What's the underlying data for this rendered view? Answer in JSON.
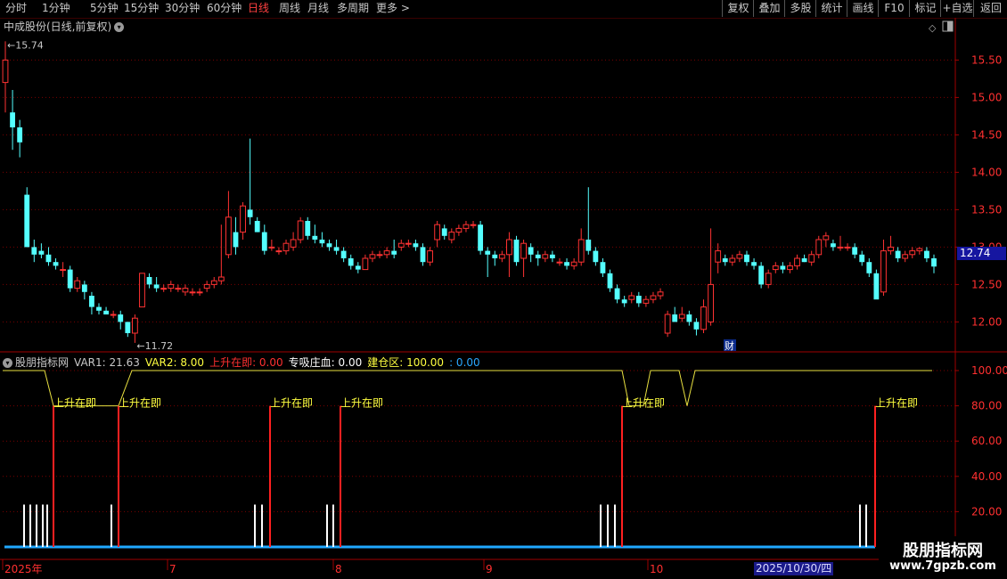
{
  "toolbar": {
    "tabs": [
      {
        "label": "分时",
        "active": false
      },
      {
        "label": "1分钟",
        "active": false
      },
      {
        "label": "5分钟",
        "active": false
      },
      {
        "label": "15分钟",
        "active": false
      },
      {
        "label": "30分钟",
        "active": false
      },
      {
        "label": "60分钟",
        "active": false
      },
      {
        "label": "日线",
        "active": true
      },
      {
        "label": "周线",
        "active": false
      },
      {
        "label": "月线",
        "active": false
      },
      {
        "label": "多周期",
        "active": false
      },
      {
        "label": "更多 >",
        "active": false
      }
    ],
    "right_buttons": [
      "复权",
      "叠加",
      "多股",
      "统计",
      "画线",
      "F10",
      "标记",
      "+自选",
      "返回"
    ]
  },
  "main_chart": {
    "title": "中成股份(日线,前复权)",
    "title_menu_icon": "chevron-down-icon",
    "high_label": "15.74",
    "low_label": "11.72",
    "marker_label": "财",
    "current_price": "12.74",
    "y_ticks": [
      "15.50",
      "15.00",
      "14.50",
      "14.00",
      "13.50",
      "13.00",
      "12.50",
      "12.00"
    ],
    "up_color": "#ff3232",
    "down_color": "#54ffff"
  },
  "indicator": {
    "name": "股朋指标网",
    "var1": "VAR1: 21.63",
    "var2": "VAR2: 8.00",
    "rise": "上升在即: 0.00",
    "zhuan": "专吸庄血: 0.00",
    "build": "建仓区: 100.00",
    "extra": ": 0.00",
    "signal_label": "上升在即",
    "y_ticks": [
      "100.00",
      "80.00",
      "60.00",
      "40.00",
      "20.00"
    ]
  },
  "x_axis": {
    "labels": [
      "2025年",
      "7",
      "8",
      "9",
      "10"
    ],
    "date_badge": "2025/10/30/四"
  },
  "watermark": {
    "title": "股朋指标网",
    "url": "www.7gpzb.com"
  },
  "chart_data": {
    "type": "candlestick",
    "title": "中成股份(日线,前复权)",
    "candles": [
      [
        15.2,
        15.75,
        14.8,
        15.5
      ],
      [
        14.8,
        15.1,
        14.3,
        14.6
      ],
      [
        14.6,
        14.7,
        14.2,
        14.4
      ],
      [
        13.7,
        13.8,
        13.0,
        13.0
      ],
      [
        13.0,
        13.1,
        12.8,
        12.9
      ],
      [
        12.95,
        13.05,
        12.85,
        12.9
      ],
      [
        12.9,
        13.0,
        12.75,
        12.8
      ],
      [
        12.8,
        12.85,
        12.7,
        12.75
      ],
      [
        12.7,
        12.8,
        12.6,
        12.7
      ],
      [
        12.7,
        12.75,
        12.4,
        12.45
      ],
      [
        12.45,
        12.6,
        12.4,
        12.55
      ],
      [
        12.5,
        12.55,
        12.3,
        12.4
      ],
      [
        12.35,
        12.4,
        12.1,
        12.2
      ],
      [
        12.2,
        12.25,
        12.1,
        12.15
      ],
      [
        12.15,
        12.2,
        12.1,
        12.1
      ],
      [
        12.1,
        12.15,
        12.05,
        12.1
      ],
      [
        12.1,
        12.15,
        11.9,
        12.0
      ],
      [
        12.0,
        12.0,
        11.8,
        11.85
      ],
      [
        11.85,
        12.1,
        11.72,
        12.05
      ],
      [
        12.2,
        12.65,
        12.2,
        12.65
      ],
      [
        12.6,
        12.65,
        12.45,
        12.5
      ],
      [
        12.5,
        12.6,
        12.4,
        12.45
      ],
      [
        12.45,
        12.5,
        12.4,
        12.45
      ],
      [
        12.45,
        12.55,
        12.4,
        12.5
      ],
      [
        12.45,
        12.5,
        12.4,
        12.45
      ],
      [
        12.4,
        12.5,
        12.35,
        12.45
      ],
      [
        12.4,
        12.45,
        12.35,
        12.4
      ],
      [
        12.4,
        12.45,
        12.35,
        12.4
      ],
      [
        12.45,
        12.55,
        12.4,
        12.5
      ],
      [
        12.5,
        12.6,
        12.45,
        12.55
      ],
      [
        12.55,
        13.3,
        12.5,
        12.6
      ],
      [
        12.9,
        13.75,
        12.85,
        13.4
      ],
      [
        13.2,
        13.4,
        12.9,
        13.0
      ],
      [
        13.2,
        13.6,
        13.1,
        13.55
      ],
      [
        13.5,
        14.45,
        13.3,
        13.4
      ],
      [
        13.35,
        13.4,
        13.2,
        13.2
      ],
      [
        13.2,
        13.3,
        12.9,
        12.95
      ],
      [
        13.0,
        13.1,
        12.95,
        13.0
      ],
      [
        12.95,
        13.0,
        12.9,
        12.95
      ],
      [
        12.95,
        13.1,
        12.9,
        13.05
      ],
      [
        13.0,
        13.2,
        12.95,
        13.1
      ],
      [
        13.1,
        13.4,
        13.05,
        13.35
      ],
      [
        13.35,
        13.4,
        13.1,
        13.15
      ],
      [
        13.15,
        13.3,
        13.05,
        13.1
      ],
      [
        13.1,
        13.2,
        13.0,
        13.05
      ],
      [
        13.05,
        13.1,
        12.95,
        13.0
      ],
      [
        13.0,
        13.1,
        12.9,
        12.95
      ],
      [
        12.95,
        13.0,
        12.8,
        12.85
      ],
      [
        12.85,
        12.9,
        12.7,
        12.75
      ],
      [
        12.75,
        12.8,
        12.65,
        12.7
      ],
      [
        12.7,
        12.9,
        12.7,
        12.85
      ],
      [
        12.85,
        12.95,
        12.8,
        12.9
      ],
      [
        12.9,
        12.95,
        12.85,
        12.9
      ],
      [
        12.9,
        13.0,
        12.85,
        12.95
      ],
      [
        12.95,
        13.1,
        12.85,
        12.9
      ],
      [
        13.0,
        13.1,
        12.95,
        13.05
      ],
      [
        13.05,
        13.1,
        13.0,
        13.05
      ],
      [
        13.05,
        13.1,
        12.95,
        13.0
      ],
      [
        13.0,
        13.05,
        12.75,
        12.8
      ],
      [
        12.8,
        13.0,
        12.75,
        12.95
      ],
      [
        13.1,
        13.35,
        13.0,
        13.3
      ],
      [
        13.25,
        13.3,
        13.1,
        13.15
      ],
      [
        13.1,
        13.25,
        13.05,
        13.2
      ],
      [
        13.2,
        13.3,
        13.15,
        13.25
      ],
      [
        13.25,
        13.35,
        13.2,
        13.3
      ],
      [
        13.3,
        13.35,
        13.25,
        13.3
      ],
      [
        13.3,
        13.35,
        12.9,
        12.95
      ],
      [
        12.95,
        13.0,
        12.6,
        12.9
      ],
      [
        12.9,
        12.95,
        12.75,
        12.85
      ],
      [
        12.85,
        12.95,
        12.8,
        12.9
      ],
      [
        12.9,
        13.2,
        12.6,
        13.1
      ],
      [
        13.1,
        13.15,
        12.75,
        12.8
      ],
      [
        12.85,
        13.1,
        12.6,
        13.05
      ],
      [
        13.0,
        13.05,
        12.8,
        12.9
      ],
      [
        12.9,
        12.95,
        12.75,
        12.85
      ],
      [
        12.85,
        12.95,
        12.8,
        12.9
      ],
      [
        12.9,
        12.95,
        12.8,
        12.85
      ],
      [
        12.8,
        12.85,
        12.75,
        12.8
      ],
      [
        12.8,
        12.85,
        12.7,
        12.75
      ],
      [
        12.75,
        12.85,
        12.7,
        12.8
      ],
      [
        12.8,
        13.25,
        12.75,
        13.1
      ],
      [
        13.1,
        13.8,
        12.9,
        12.95
      ],
      [
        12.95,
        13.0,
        12.75,
        12.8
      ],
      [
        12.8,
        12.85,
        12.6,
        12.65
      ],
      [
        12.65,
        12.7,
        12.4,
        12.45
      ],
      [
        12.45,
        12.5,
        12.25,
        12.3
      ],
      [
        12.3,
        12.35,
        12.2,
        12.25
      ],
      [
        12.3,
        12.4,
        12.25,
        12.35
      ],
      [
        12.35,
        12.4,
        12.2,
        12.25
      ],
      [
        12.25,
        12.35,
        12.2,
        12.3
      ],
      [
        12.3,
        12.4,
        12.25,
        12.35
      ],
      [
        12.35,
        12.45,
        12.3,
        12.4
      ],
      [
        11.85,
        12.15,
        11.8,
        12.1
      ],
      [
        12.1,
        12.2,
        12.0,
        12.0
      ],
      [
        12.05,
        12.2,
        12.0,
        12.1
      ],
      [
        12.1,
        12.15,
        11.95,
        12.0
      ],
      [
        12.0,
        12.05,
        11.82,
        11.9
      ],
      [
        11.9,
        12.3,
        11.85,
        12.2
      ],
      [
        12.0,
        13.25,
        11.95,
        12.5
      ],
      [
        12.8,
        13.05,
        12.65,
        12.95
      ],
      [
        12.85,
        12.9,
        12.75,
        12.8
      ],
      [
        12.8,
        12.9,
        12.75,
        12.85
      ],
      [
        12.85,
        12.95,
        12.8,
        12.9
      ],
      [
        12.9,
        12.95,
        12.75,
        12.8
      ],
      [
        12.8,
        12.85,
        12.7,
        12.75
      ],
      [
        12.75,
        12.8,
        12.45,
        12.5
      ],
      [
        12.5,
        12.7,
        12.45,
        12.65
      ],
      [
        12.7,
        12.8,
        12.65,
        12.75
      ],
      [
        12.75,
        12.8,
        12.65,
        12.7
      ],
      [
        12.7,
        12.8,
        12.65,
        12.75
      ],
      [
        12.75,
        12.9,
        12.7,
        12.85
      ],
      [
        12.85,
        12.9,
        12.8,
        12.8
      ],
      [
        12.8,
        12.95,
        12.75,
        12.9
      ],
      [
        12.9,
        13.15,
        12.85,
        13.1
      ],
      [
        13.1,
        13.2,
        13.0,
        13.15
      ],
      [
        13.05,
        13.1,
        12.95,
        13.0
      ],
      [
        13.0,
        13.15,
        12.95,
        13.0
      ],
      [
        13.0,
        13.05,
        12.95,
        13.0
      ],
      [
        13.0,
        13.05,
        12.85,
        12.9
      ],
      [
        12.9,
        12.95,
        12.75,
        12.8
      ],
      [
        12.8,
        12.85,
        12.6,
        12.65
      ],
      [
        12.65,
        12.7,
        12.35,
        12.3
      ],
      [
        12.4,
        13.1,
        12.35,
        12.95
      ],
      [
        12.95,
        13.15,
        12.9,
        13.0
      ],
      [
        12.95,
        13.0,
        12.8,
        12.85
      ],
      [
        12.85,
        12.95,
        12.8,
        12.9
      ],
      [
        12.9,
        13.0,
        12.85,
        12.95
      ],
      [
        12.95,
        13.0,
        12.9,
        12.98
      ],
      [
        12.95,
        13.0,
        12.8,
        12.85
      ],
      [
        12.85,
        12.9,
        12.65,
        12.74
      ]
    ],
    "ylim": [
      11.6,
      15.85
    ],
    "indicator_series": {
      "build_zone": [
        100,
        100,
        100,
        100,
        100,
        100,
        100,
        100,
        100,
        100,
        100,
        100,
        100,
        100,
        80,
        80,
        80,
        80,
        80,
        80,
        80,
        80,
        80,
        80,
        80,
        80,
        80,
        80,
        80,
        80,
        80,
        80,
        80,
        80,
        80,
        80,
        80,
        80,
        80,
        80,
        80,
        100,
        100,
        100,
        100,
        100,
        100,
        100,
        100,
        100,
        100,
        100,
        100,
        100,
        100,
        100,
        100,
        100,
        100,
        100,
        100,
        100,
        100,
        100,
        100,
        100,
        100,
        100,
        100,
        100,
        100,
        100,
        100,
        100,
        100,
        100,
        100,
        100,
        100,
        100,
        100,
        100,
        100,
        100,
        100,
        100,
        100,
        100,
        100,
        100,
        100,
        100,
        100,
        100,
        100,
        100,
        100,
        100,
        100,
        100,
        100,
        100,
        100,
        100,
        100,
        100,
        100,
        100,
        100,
        100,
        100,
        100,
        100,
        100,
        100,
        100,
        100,
        100,
        100,
        100,
        100,
        100,
        100,
        100,
        100,
        100,
        100,
        100,
        100,
        100,
        100,
        100,
        100,
        100,
        100,
        100,
        100,
        100,
        100,
        100,
        100,
        100,
        100,
        100,
        100,
        100,
        100,
        100,
        100,
        100,
        100,
        100,
        100,
        100,
        100,
        100,
        100,
        100,
        100,
        100,
        100,
        100,
        100,
        100,
        100,
        100,
        100,
        100,
        100,
        100,
        100,
        100,
        100,
        100,
        100,
        100,
        100,
        100,
        100,
        100,
        100,
        100,
        100,
        100,
        100,
        100,
        100,
        100,
        100,
        100,
        100,
        100,
        100,
        100,
        100,
        100,
        100,
        100,
        100,
        100,
        100,
        100,
        100,
        100,
        100,
        100,
        100,
        100,
        100,
        100,
        100,
        100,
        100,
        100,
        100,
        100,
        100,
        100,
        100,
        100,
        100,
        100,
        100,
        100,
        100,
        100,
        100,
        100,
        100,
        100,
        100,
        100,
        100,
        100,
        100,
        100,
        100,
        100,
        100,
        100,
        100,
        100,
        100,
        100,
        100,
        100,
        100,
        100,
        100,
        100,
        100,
        100,
        100,
        100,
        100,
        100,
        100,
        100,
        100,
        100,
        100,
        100,
        100,
        100,
        100,
        100,
        100,
        100,
        100,
        100,
        100,
        100,
        100,
        100,
        100,
        100,
        100,
        100,
        100
      ],
      "signal_bars": [
        60,
        133,
        303,
        382,
        698,
        982
      ],
      "white_bars": [
        27,
        34,
        41,
        48,
        53,
        125,
        286,
        294,
        367,
        374,
        674,
        682,
        690,
        965,
        972
      ]
    }
  }
}
